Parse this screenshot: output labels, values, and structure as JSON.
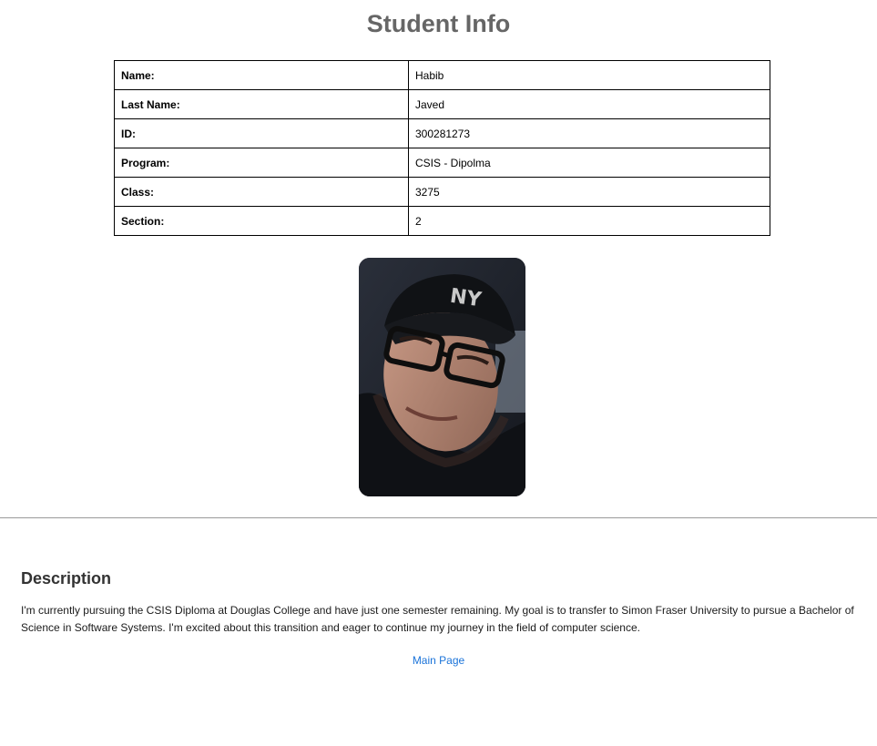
{
  "page": {
    "title": "Student Info"
  },
  "student_info": {
    "rows": [
      {
        "label": "Name:",
        "value": "Habib"
      },
      {
        "label": "Last Name:",
        "value": "Javed"
      },
      {
        "label": "ID:",
        "value": "300281273"
      },
      {
        "label": "Program:",
        "value": "CSIS - Dipolma"
      },
      {
        "label": "Class:",
        "value": "3275"
      },
      {
        "label": "Section:",
        "value": "2"
      }
    ]
  },
  "photo": {
    "alt": "student-photo"
  },
  "description": {
    "heading": "Description",
    "text": "I'm currently pursuing the CSIS Diploma at Douglas College and have just one semester remaining. My goal is to transfer to Simon Fraser University to pursue a Bachelor of Science in Software Systems. I'm excited about this transition and eager to continue my journey in the field of computer science."
  },
  "nav": {
    "main_page_label": "Main Page"
  },
  "colors": {
    "title": "#666666",
    "link": "#1a73d9",
    "divider": "#9a9a9a"
  }
}
